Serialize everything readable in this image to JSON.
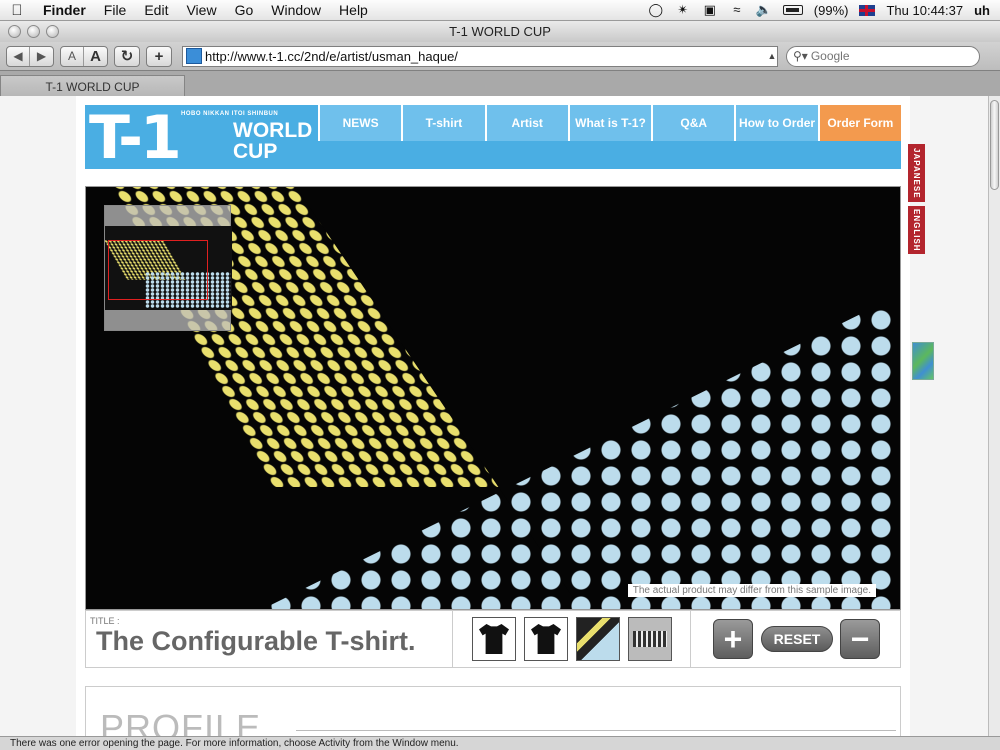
{
  "menubar": {
    "app": "Finder",
    "items": [
      "File",
      "Edit",
      "View",
      "Go",
      "Window",
      "Help"
    ],
    "battery": "(99%)",
    "clock": "Thu 10:44:37",
    "user": "uh"
  },
  "window": {
    "title": "T-1 WORLD CUP"
  },
  "toolbar": {
    "back_icon": "back-arrow-icon",
    "forward_icon": "forward-arrow-icon",
    "font_small": "A",
    "font_large": "A",
    "reload_icon": "reload-icon",
    "add_icon": "+",
    "url": "http://www.t-1.cc/2nd/e/artist/usman_haque/",
    "search_placeholder": "Google"
  },
  "tabs": [
    {
      "label": "T-1 WORLD CUP"
    }
  ],
  "site": {
    "logo_small": "HOBO NIKKAN ITOI SHINBUN",
    "logo_main": "T-1",
    "logo_world": "WORLD",
    "logo_cup": "CUP",
    "nav": [
      "NEWS",
      "T-shirt",
      "Artist",
      "What is T-1?",
      "Q&A",
      "How to Order",
      "Order Form"
    ],
    "lang_ja": "JAPANESE",
    "lang_en": "ENGLISH",
    "disclaimer": "The actual product may differ from this sample image.",
    "title_label": "TITLE :",
    "product_title": "The Configurable T-shirt.",
    "reset_label": "RESET",
    "plus_label": "+",
    "minus_label": "−",
    "profile_heading": "PROFILE"
  },
  "status": {
    "message": "There was one error opening the page. For more information, choose Activity from the Window menu."
  },
  "colors": {
    "nav_blue": "#4aaee3",
    "order_orange": "#f39a4e",
    "lang_red": "#b3252d"
  }
}
